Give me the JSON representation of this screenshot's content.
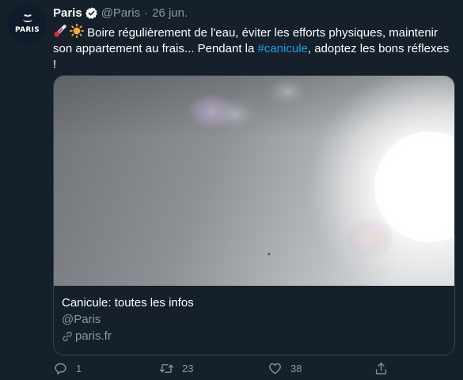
{
  "author": {
    "name": "Paris",
    "handle": "@Paris",
    "separator": "·",
    "date": "26 jun.",
    "avatar_text": "PARIS"
  },
  "tweet": {
    "text_part1": " Boire régulièrement de l'eau, éviter les efforts physiques, maintenir son appartement au frais...  Pendant la ",
    "hashtag": "#canicule",
    "text_part2": ", adoptez les bons réflexes !"
  },
  "card": {
    "title": "Canicule: toutes les infos",
    "handle": "@Paris",
    "domain": "paris.fr"
  },
  "actions": {
    "replies": "1",
    "retweets": "23",
    "likes": "38"
  },
  "icons": {
    "emoji1": "thermometer-emoji",
    "emoji2": "sun-emoji",
    "verified": "verified-badge-icon",
    "reply": "reply-icon",
    "retweet": "retweet-icon",
    "like": "heart-icon",
    "share": "share-icon",
    "link": "link-icon"
  },
  "colors": {
    "background": "#15202b",
    "accent": "#1da1f2",
    "muted": "#8899a6",
    "border": "#38444d"
  }
}
